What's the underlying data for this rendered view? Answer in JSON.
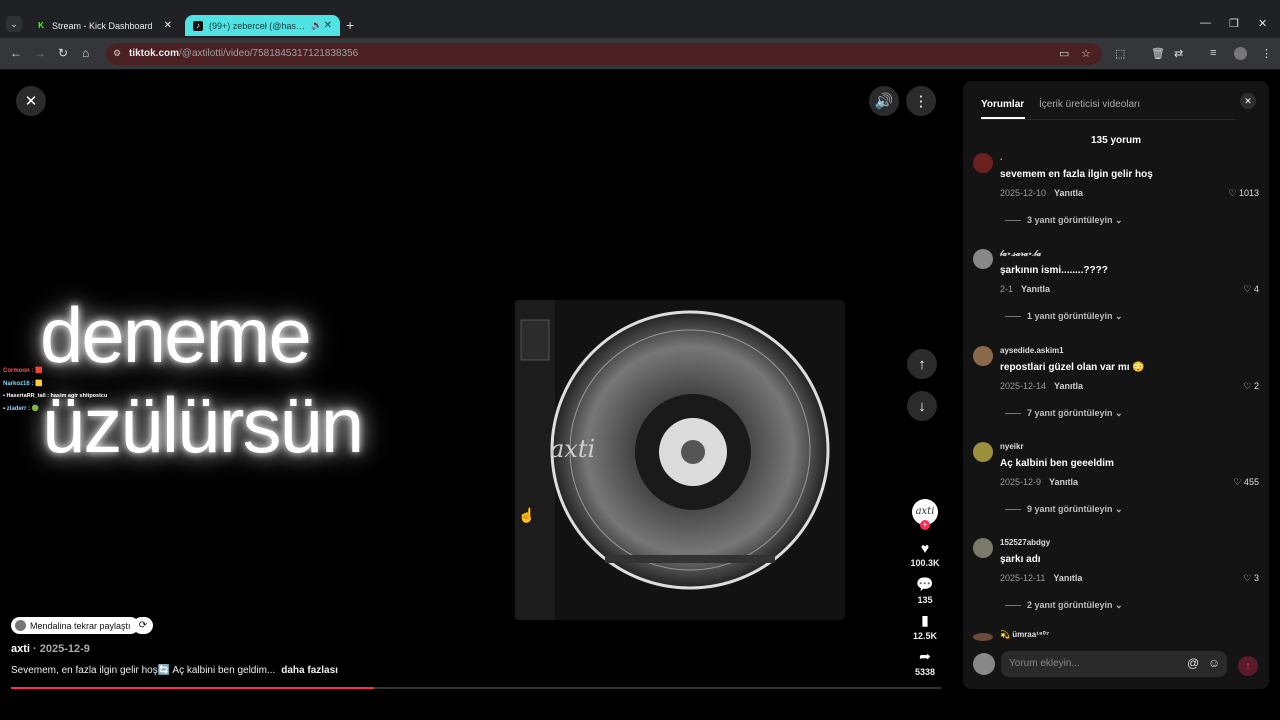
{
  "browser": {
    "tabs": [
      {
        "title": "Stream - Kick Dashboard",
        "active": false
      },
      {
        "title": "(99+) zeberceł (@hasimsw_",
        "active": true
      }
    ],
    "url_host": "tiktok.com",
    "url_path": "/@axtilotti/video/7581845317121838356"
  },
  "video": {
    "overlay_line1": "deneme",
    "overlay_line2": "üzülürsün",
    "disc_text": "axti",
    "progress_fraction": 0.39,
    "chat": [
      {
        "user": "Cormoon :",
        "color": "#ff5a5a"
      },
      {
        "user": "Narkoz16 :",
        "color": "#7fd8ff"
      },
      {
        "user": "HasertaRR_tall : hasim agir shitpostcu",
        "color": "#ffffff"
      },
      {
        "user": "zladerr :",
        "color": "#8fd3ff"
      }
    ],
    "actions": {
      "likes": "100.3K",
      "comments": "135",
      "saves": "12.5K",
      "shares": "5338"
    },
    "repost_label": "Mendalina tekrar paylaştı",
    "author": "axti",
    "date": "2025-12-9",
    "caption": "Sevemem, en fazla ilgin gelir hoş🔄 Aç kalbini ben geldim...",
    "more": "daha fazlası"
  },
  "panel": {
    "tab_comments": "Yorumlar",
    "tab_creator": "İçerik üreticisi videoları",
    "count_label": "135 yorum",
    "reply_label": "Yanıtla",
    "comments": [
      {
        "user": ".",
        "text": "sevemem en fazla ilgin gelir hoş",
        "date": "2025-12-10",
        "likes": "1013",
        "view": "3 yanıt görüntüleyin",
        "avatar": "#6b1f1f"
      },
      {
        "user": "𝓁𝒶⋆.𝓈𝒶𝓇𝒶⋆.𝓁𝒶",
        "text": "şarkının ismi........????",
        "date": "2-1",
        "likes": "4",
        "view": "1 yanıt görüntüleyin",
        "avatar": "#888888"
      },
      {
        "user": "aysedide.askim1",
        "text": "repostlari güzel olan var mı 😳",
        "date": "2025-12-14",
        "likes": "2",
        "view": "7 yanıt görüntüleyin",
        "avatar": "#8a6a4a"
      },
      {
        "user": "nyeikr",
        "text": "Aç kalbini ben geeeldim",
        "date": "2025-12-9",
        "likes": "455",
        "view": "9 yanıt görüntüleyin",
        "avatar": "#9a9040"
      },
      {
        "user": "152527abdgy",
        "text": "şarkı adı",
        "date": "2025-12-11",
        "likes": "3",
        "view": "2 yanıt görüntüleyin",
        "avatar": "#7a7a6a"
      }
    ],
    "partial_user": "ümraa¹⁹⁰⁷",
    "input_placeholder": "Yorum ekleyin..."
  }
}
